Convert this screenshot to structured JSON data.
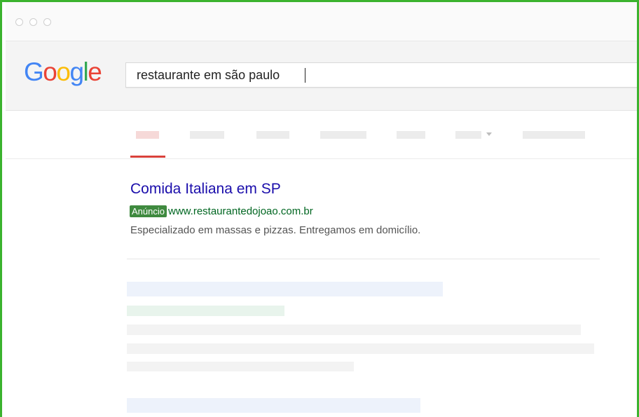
{
  "browser": {
    "window_controls": [
      "close",
      "minimize",
      "maximize"
    ]
  },
  "logo": {
    "letters": [
      "G",
      "o",
      "o",
      "g",
      "l",
      "e"
    ],
    "colors": [
      "#4285f4",
      "#ea4335",
      "#fbbc05",
      "#4285f4",
      "#34a853",
      "#ea4335"
    ]
  },
  "search": {
    "query": "restaurante em são paulo"
  },
  "result": {
    "title": "Comida Italiana em SP",
    "ad_badge": "Anúncio",
    "url": "www.restaurantedojoao.com.br",
    "snippet": "Especializado em massas e pizzas. Entregamos em domicílio."
  },
  "colors": {
    "frame_border": "#3bb32e",
    "link_title": "#1a0dab",
    "url_green": "#006621",
    "ad_badge_bg": "#3f8a3f",
    "active_tab_underline": "#d9413b"
  }
}
